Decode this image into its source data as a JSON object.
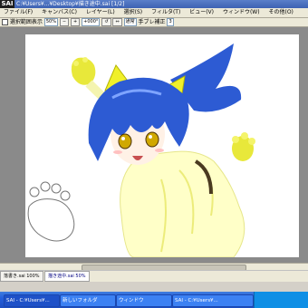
{
  "app": {
    "logo": "SAI",
    "title": "C:¥Users¥...¥Desktop¥描き途中.sai [1/2]"
  },
  "menu": [
    "ファイル(F)",
    "キャンバス(C)",
    "レイヤー(L)",
    "選択(S)",
    "フィルタ(T)",
    "ビュー(V)",
    "ウィンドウ(W)",
    "その他(O)"
  ],
  "toolbar": {
    "selection_label": "選択範囲表示",
    "zoom": "50%",
    "angle": "+000°",
    "mode": "通常",
    "stabilizer_label": "手ブレ補正",
    "stabilizer_value": "3"
  },
  "tabs": [
    {
      "label": "落書き.sai",
      "zoom": "100%"
    },
    {
      "label": "描き途中.sai",
      "zoom": "50%"
    }
  ],
  "taskbar": [
    {
      "label": "SAI - C:¥Users¥..."
    },
    {
      "label": "新しいフォルダ"
    },
    {
      "label": "ウィンドウ"
    },
    {
      "label": "SAI - C:¥Users¥..."
    }
  ],
  "colors": {
    "hair": "#2d5bd3",
    "ears": "#f0f02a",
    "eyes": "#d0a800",
    "skin": "#fff1e6",
    "cloth": "#ffffc8"
  }
}
